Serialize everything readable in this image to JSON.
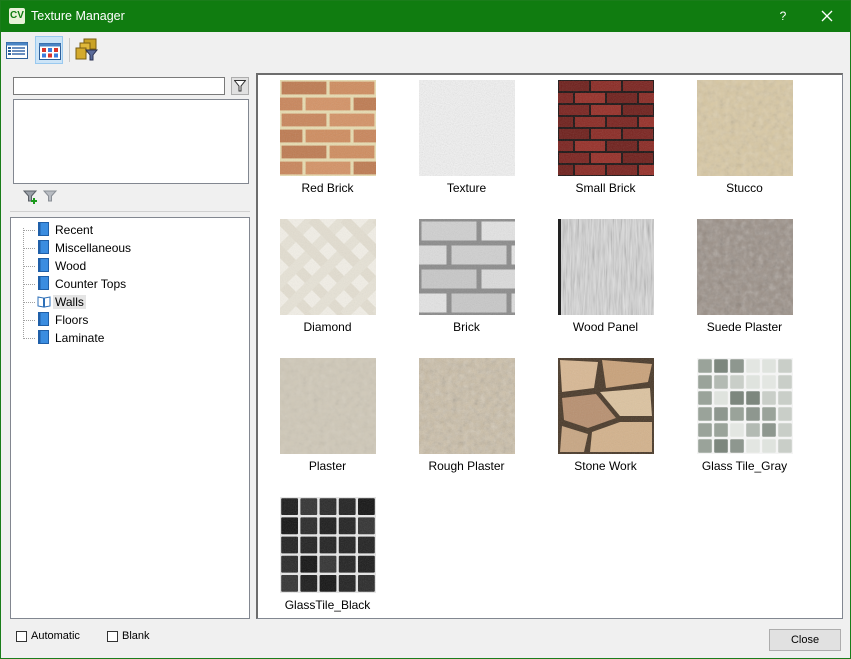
{
  "window": {
    "title": "Texture Manager",
    "app_icon_text": "CV",
    "help_label": "?",
    "accent_color": "#107c10"
  },
  "toolbar": {
    "buttons": [
      {
        "icon": "list-view-icon",
        "active": false
      },
      {
        "icon": "thumbnail-view-icon",
        "active": true
      },
      {
        "icon": "filter-manager-icon",
        "active": false
      }
    ]
  },
  "filter": {
    "search_value": "",
    "list_items": []
  },
  "tree": {
    "items": [
      {
        "label": "Recent",
        "open": false
      },
      {
        "label": "Miscellaneous",
        "open": false
      },
      {
        "label": "Wood",
        "open": false
      },
      {
        "label": "Counter Tops",
        "open": false
      },
      {
        "label": "Walls",
        "open": true,
        "selected": true
      },
      {
        "label": "Floors",
        "open": false
      },
      {
        "label": "Laminate",
        "open": false
      }
    ]
  },
  "textures": [
    {
      "name": "Red Brick",
      "pattern": "red-brick"
    },
    {
      "name": "Texture",
      "pattern": "texture"
    },
    {
      "name": "Small Brick",
      "pattern": "small-brick"
    },
    {
      "name": "Stucco",
      "pattern": "stucco"
    },
    {
      "name": "Diamond",
      "pattern": "diamond"
    },
    {
      "name": "Brick",
      "pattern": "brick"
    },
    {
      "name": "Wood Panel",
      "pattern": "wood-panel"
    },
    {
      "name": "Suede Plaster",
      "pattern": "suede-plaster"
    },
    {
      "name": "Plaster",
      "pattern": "plaster"
    },
    {
      "name": "Rough Plaster",
      "pattern": "rough-plaster"
    },
    {
      "name": "Stone Work",
      "pattern": "stone-work"
    },
    {
      "name": "Glass Tile_Gray",
      "pattern": "glass-tile-gray"
    },
    {
      "name": "GlassTile_Black",
      "pattern": "glass-tile-black"
    }
  ],
  "footer": {
    "automatic_label": "Automatic",
    "automatic_checked": false,
    "blank_label": "Blank",
    "blank_checked": false,
    "close_label": "Close"
  }
}
